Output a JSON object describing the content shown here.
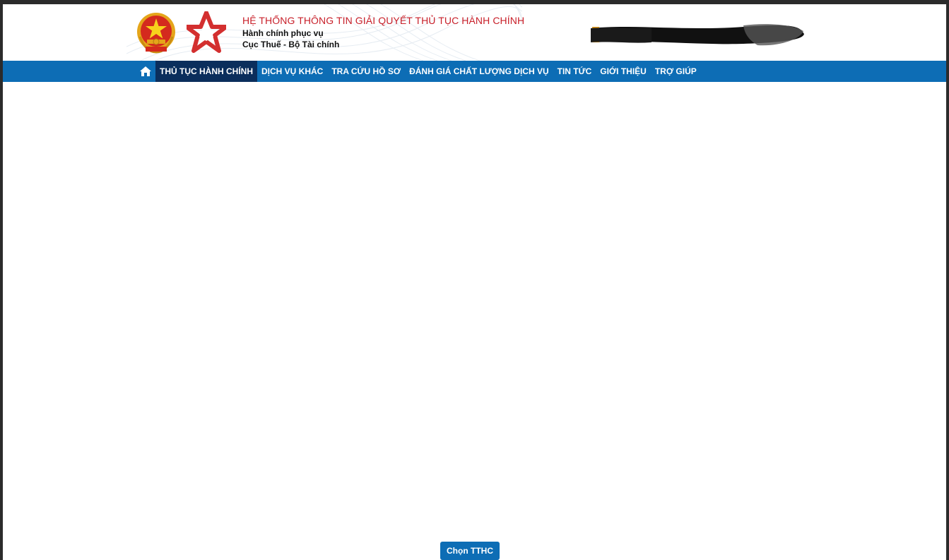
{
  "header": {
    "title": "HỆ THỐNG THÔNG TIN GIẢI QUYẾT THỦ TỤC HÀNH CHÍNH",
    "subtitle": "Hành chính phục vụ",
    "agency": "Cục Thuế - Bộ Tài chính"
  },
  "nav": {
    "home_icon": "home-icon",
    "items": [
      {
        "label": "THỦ TỤC HÀNH CHÍNH",
        "active": true
      },
      {
        "label": "DỊCH VỤ KHÁC",
        "active": false
      },
      {
        "label": "TRA CỨU HỒ SƠ",
        "active": false
      },
      {
        "label": "ĐÁNH GIÁ CHẤT LƯỢNG DỊCH VỤ",
        "active": false
      },
      {
        "label": "TIN TỨC",
        "active": false
      },
      {
        "label": "GIỚI THIỆU",
        "active": false
      },
      {
        "label": "TRỢ GIÚP",
        "active": false
      }
    ]
  },
  "actions": {
    "choose_procedure_label": "Chọn TTHC"
  },
  "colors": {
    "nav_bg": "#0d6db5",
    "nav_active_bg": "#0b2e5c",
    "title_red": "#c8202a",
    "button_bg": "#0d6db5"
  }
}
